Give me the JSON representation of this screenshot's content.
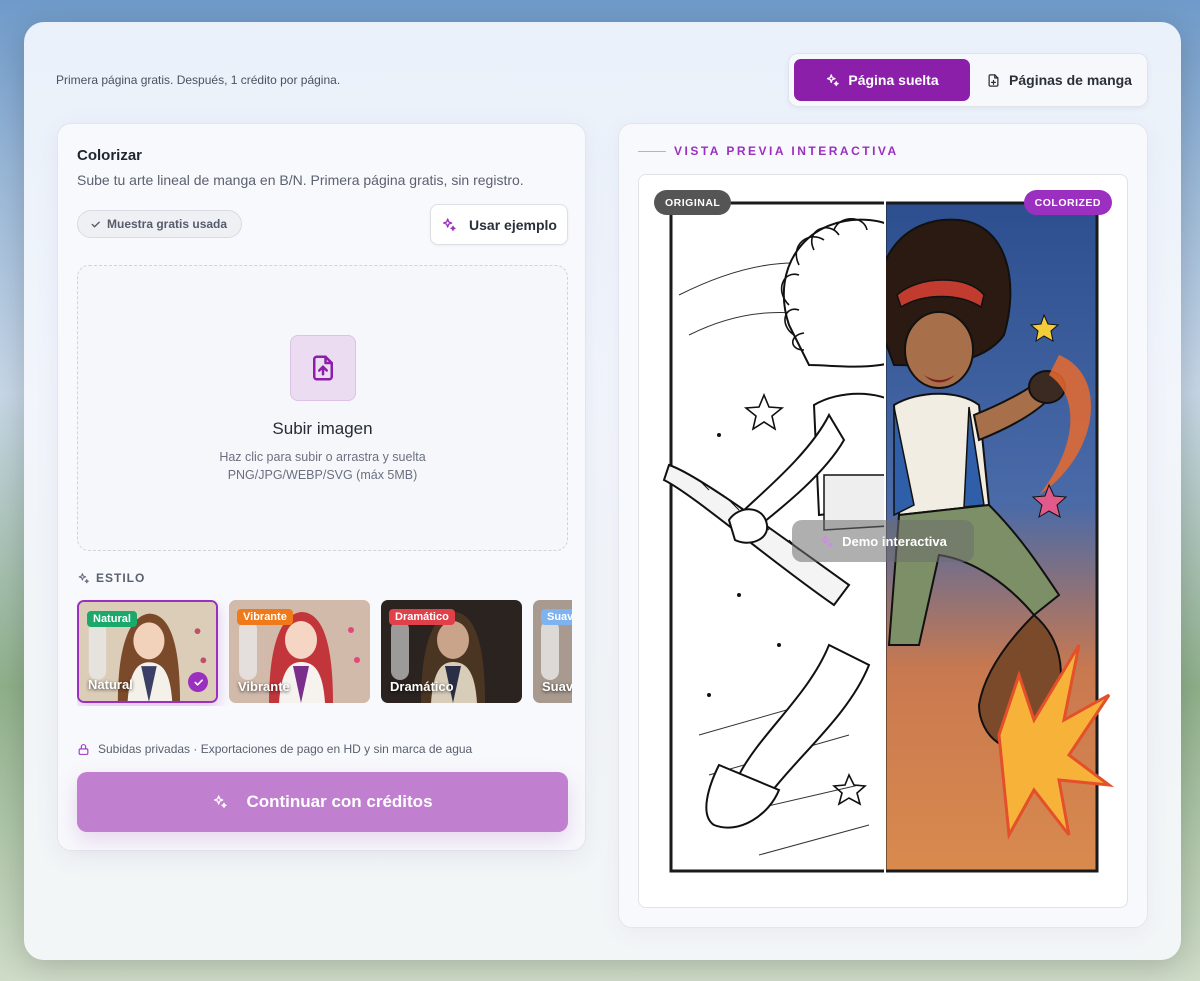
{
  "top_note": "Primera página gratis. Después, 1 crédito por página.",
  "mode_switch": {
    "single_label": "Página suelta",
    "manga_label": "Páginas de manga"
  },
  "colorize": {
    "title": "Colorizar",
    "subtitle": "Sube tu arte lineal de manga en B/N. Primera página gratis, sin registro.",
    "sample_badge": "Muestra gratis usada",
    "example_button": "Usar ejemplo",
    "upload_title": "Subir imagen",
    "upload_hint_1": "Haz clic para subir o arrastra y suelta",
    "upload_hint_2": "PNG/JPG/WEBP/SVG (máx 5MB)",
    "style_label": "ESTILO",
    "styles": [
      {
        "tag": "Natural",
        "name": "Natural",
        "tag_color": "#1aa86b",
        "selected": true
      },
      {
        "tag": "Vibrante",
        "name": "Vibrante",
        "tag_color": "#f07a1a",
        "selected": false
      },
      {
        "tag": "Dramático",
        "name": "Dramático",
        "tag_color": "#e0404a",
        "selected": false
      },
      {
        "tag": "Suav",
        "name": "Suav",
        "tag_color": "#7fb2f0",
        "selected": false
      }
    ],
    "privacy_note": "Subidas privadas · Exportaciones de pago en HD y sin marca de agua",
    "continue_button": "Continuar con créditos"
  },
  "preview": {
    "label": "VISTA PREVIA INTERACTIVA",
    "original_pill": "ORIGINAL",
    "colorized_pill": "COLORIZED",
    "demo_chip": "Demo interactiva"
  },
  "colors": {
    "accent": "#8b1fa9",
    "accent_soft": "#c17fd0"
  }
}
